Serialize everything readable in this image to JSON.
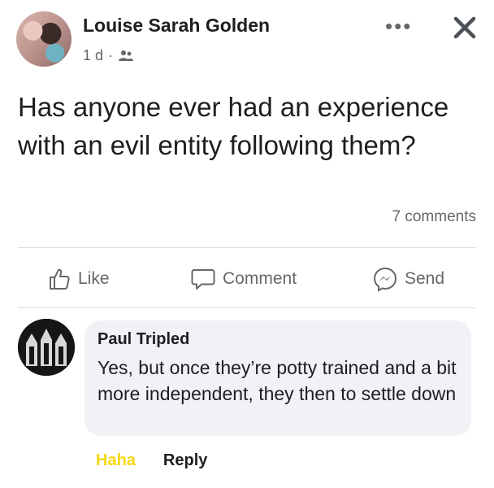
{
  "post": {
    "author": "Louise Sarah Golden",
    "time": "1 d",
    "privacy_icon": "friends-icon",
    "text": "Has anyone ever had an experience with an evil entity following them?",
    "comments_count": "7 comments"
  },
  "actions": {
    "like": "Like",
    "comment": "Comment",
    "send": "Send"
  },
  "comment": {
    "author": "Paul Tripled",
    "text": "Yes, but once they’re potty trained and a bit more independent, they then to settle down",
    "reaction_label": "Haha",
    "reply_label": "Reply"
  },
  "colors": {
    "text": "#1c1e21",
    "secondary": "#65676b",
    "bubble": "#f0f2f5",
    "haha": "#f7d80f"
  }
}
